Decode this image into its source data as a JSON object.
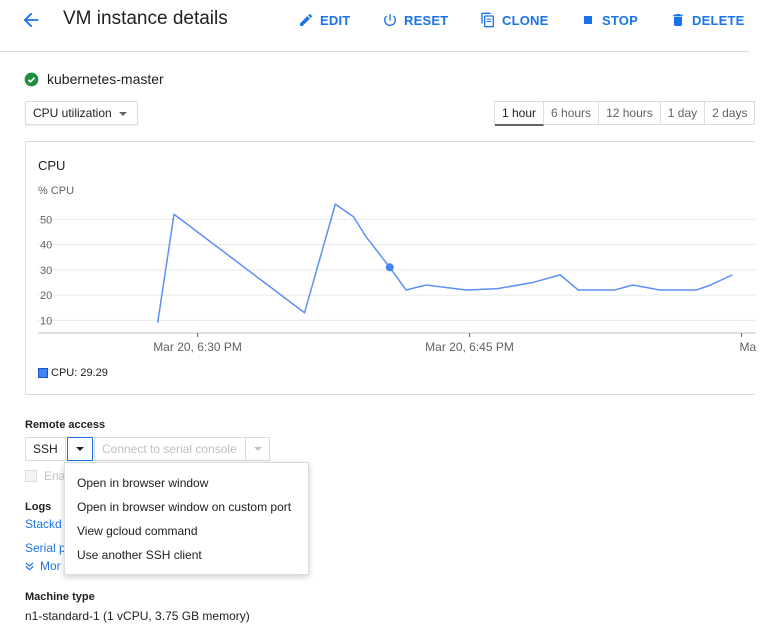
{
  "header": {
    "title": "VM instance details",
    "buttons": {
      "edit": "EDIT",
      "reset": "RESET",
      "clone": "CLONE",
      "stop": "STOP",
      "delete": "DELETE"
    }
  },
  "instance": {
    "name": "kubernetes-master",
    "status_icon": "check-circle-icon"
  },
  "metric_select": {
    "value": "CPU utilization"
  },
  "time_range": {
    "options": [
      "1 hour",
      "6 hours",
      "12 hours",
      "1 day",
      "2 days"
    ],
    "selected": "1 hour"
  },
  "chart": {
    "title": "CPU",
    "ylabel": "% CPU",
    "legend": "CPU: 29.29"
  },
  "chart_data": {
    "type": "line",
    "title": "CPU",
    "ylabel": "% CPU",
    "xlabel": "",
    "ylim": [
      5,
      60
    ],
    "y_ticks": [
      10,
      20,
      30,
      40,
      50
    ],
    "x_tick_labels": [
      "Mar 20, 6:30 PM",
      "Mar 20, 6:45 PM",
      "Mar"
    ],
    "x_tick_minutes": [
      30,
      45,
      60
    ],
    "x_unit": "minutes past 6:00 PM, Mar 20",
    "grid": true,
    "series": [
      {
        "name": "CPU",
        "color": "#5b8ff9",
        "x": [
          27.8,
          28.7,
          35.9,
          37.6,
          38.6,
          39.3,
          40.6,
          41.5,
          42.6,
          44.8,
          46.5,
          48.5,
          50.0,
          51.0,
          52.0,
          53.0,
          54.0,
          55.5,
          56.5,
          57.5,
          58.3,
          59.5
        ],
        "y": [
          9,
          52,
          13,
          56,
          51,
          43,
          31,
          22,
          24,
          22,
          22.5,
          25,
          28,
          22,
          22,
          22,
          24,
          22,
          22,
          22,
          24,
          28
        ]
      }
    ],
    "highlight_point": {
      "x": 40.6,
      "y": 31
    },
    "legend": "CPU: 29.29"
  },
  "remote_access": {
    "label": "Remote access",
    "ssh_label": "SSH",
    "serial_label": "Connect to serial console",
    "enable_label": "Ena",
    "menu_items": [
      "Open in browser window",
      "Open in browser window on custom port",
      "View gcloud command",
      "Use another SSH client"
    ]
  },
  "logs": {
    "label": "Logs",
    "stackdriver_link": "Stackd",
    "serial_link": "Serial p",
    "more_link": "Mor"
  },
  "machine_type": {
    "label": "Machine type",
    "value": "n1-standard-1 (1 vCPU, 3.75 GB memory)"
  }
}
